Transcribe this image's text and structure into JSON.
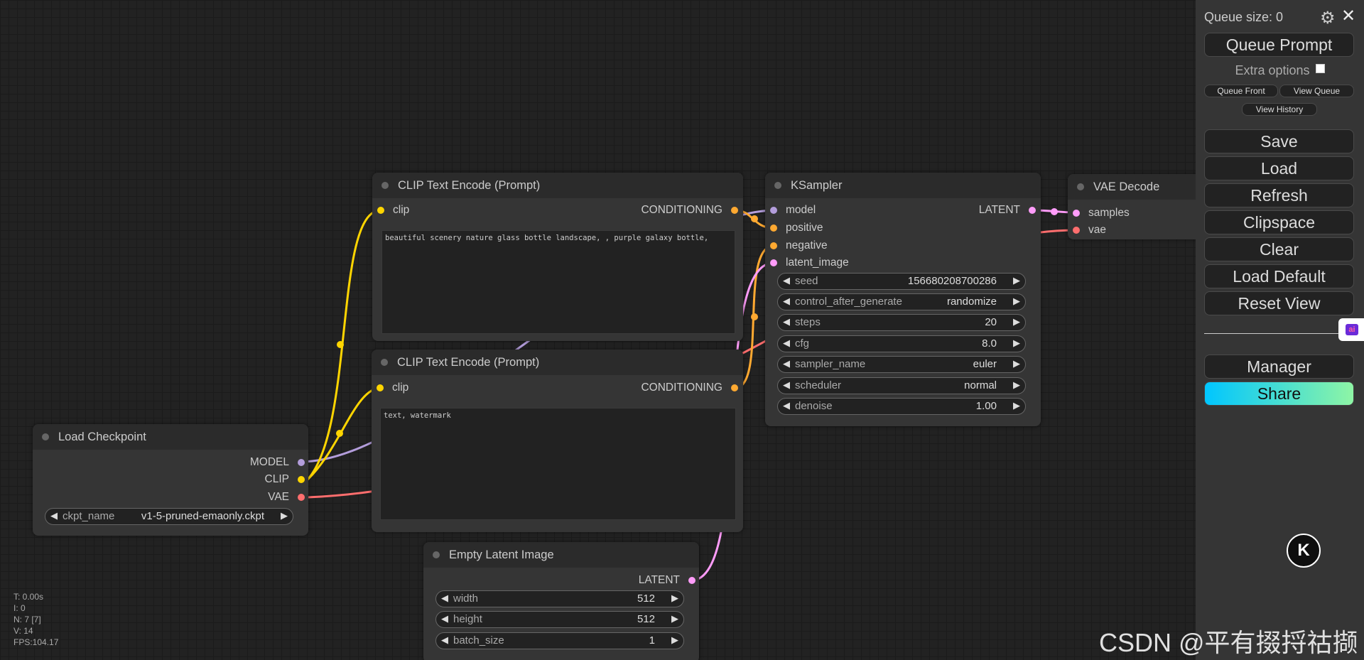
{
  "stats": {
    "t": "T: 0.00s",
    "i": "I: 0",
    "n": "N: 7 [7]",
    "v": "V: 14",
    "fps": "FPS:104.17"
  },
  "watermark": "CSDN @平有掇捋祜撷",
  "menu": {
    "queue_size": "Queue size: 0",
    "queue_prompt": "Queue Prompt",
    "extra_options": "Extra options",
    "queue_front": "Queue Front",
    "view_queue": "View Queue",
    "view_history": "View History",
    "save": "Save",
    "load": "Load",
    "refresh": "Refresh",
    "clipspace": "Clipspace",
    "clear": "Clear",
    "load_default": "Load Default",
    "reset_view": "Reset View",
    "manager": "Manager",
    "share": "Share",
    "share_gradient": [
      "#00c6ff",
      "#8ef5a5"
    ]
  },
  "colors": {
    "model": "#b39ddb",
    "clip": "#ffd500",
    "vae": "#ff6e6e",
    "conditioning": "#ffa931",
    "latent": "#ff9cf9"
  },
  "nodes": {
    "clip_pos": {
      "title": "CLIP Text Encode (Prompt)",
      "input": "clip",
      "output": "CONDITIONING",
      "text": "beautiful scenery nature glass bottle landscape, , purple galaxy bottle,"
    },
    "clip_neg": {
      "title": "CLIP Text Encode (Prompt)",
      "input": "clip",
      "output": "CONDITIONING",
      "text": "text, watermark"
    },
    "ksampler": {
      "title": "KSampler",
      "inputs": [
        "model",
        "positive",
        "negative",
        "latent_image"
      ],
      "output": "LATENT",
      "widgets": [
        {
          "label": "seed",
          "value": "156680208700286"
        },
        {
          "label": "control_after_generate",
          "value": "randomize"
        },
        {
          "label": "steps",
          "value": "20"
        },
        {
          "label": "cfg",
          "value": "8.0"
        },
        {
          "label": "sampler_name",
          "value": "euler"
        },
        {
          "label": "scheduler",
          "value": "normal"
        },
        {
          "label": "denoise",
          "value": "1.00"
        }
      ]
    },
    "vae_decode": {
      "title": "VAE Decode",
      "inputs": [
        "samples",
        "vae"
      ]
    },
    "checkpoint": {
      "title": "Load Checkpoint",
      "outputs": [
        "MODEL",
        "CLIP",
        "VAE"
      ],
      "widget": {
        "label": "ckpt_name",
        "value": "v1-5-pruned-emaonly.ckpt"
      }
    },
    "latent": {
      "title": "Empty Latent Image",
      "output": "LATENT",
      "widgets": [
        {
          "label": "width",
          "value": "512"
        },
        {
          "label": "height",
          "value": "512"
        },
        {
          "label": "batch_size",
          "value": "1"
        }
      ]
    }
  }
}
